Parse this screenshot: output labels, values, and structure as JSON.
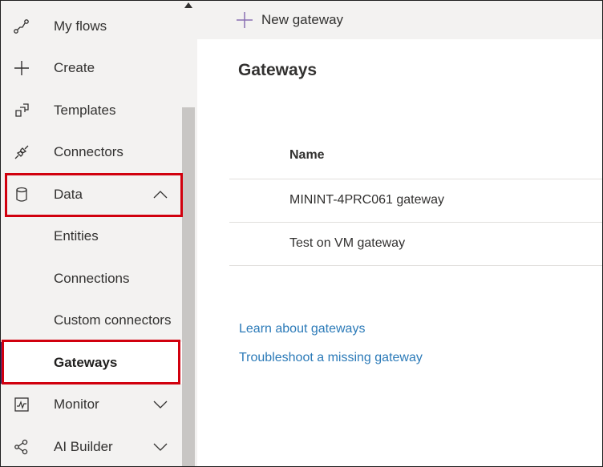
{
  "sidebar": {
    "items": [
      {
        "label": "My flows",
        "icon": "flow-icon"
      },
      {
        "label": "Create",
        "icon": "plus-icon"
      },
      {
        "label": "Templates",
        "icon": "templates-icon"
      },
      {
        "label": "Connectors",
        "icon": "connector-icon"
      },
      {
        "label": "Data",
        "icon": "database-icon",
        "expanded": true
      },
      {
        "label": "Monitor",
        "icon": "monitor-icon"
      },
      {
        "label": "AI Builder",
        "icon": "ai-builder-icon"
      }
    ],
    "data_subitems": [
      {
        "label": "Entities"
      },
      {
        "label": "Connections"
      },
      {
        "label": "Custom connectors"
      },
      {
        "label": "Gateways",
        "active": true
      }
    ]
  },
  "command_bar": {
    "new_gateway_label": "New gateway"
  },
  "main": {
    "title": "Gateways",
    "table": {
      "columns": [
        "Name"
      ],
      "rows": [
        {
          "name": "MININT-4PRC061 gateway"
        },
        {
          "name": "Test on VM gateway"
        }
      ]
    },
    "links": {
      "learn": "Learn about gateways",
      "troubleshoot": "Troubleshoot a missing gateway"
    }
  },
  "colors": {
    "highlight": "#d1000e",
    "link": "#2b7ab8",
    "active_indicator": "#3b2e8a",
    "sidebar_bg": "#f3f2f1"
  }
}
